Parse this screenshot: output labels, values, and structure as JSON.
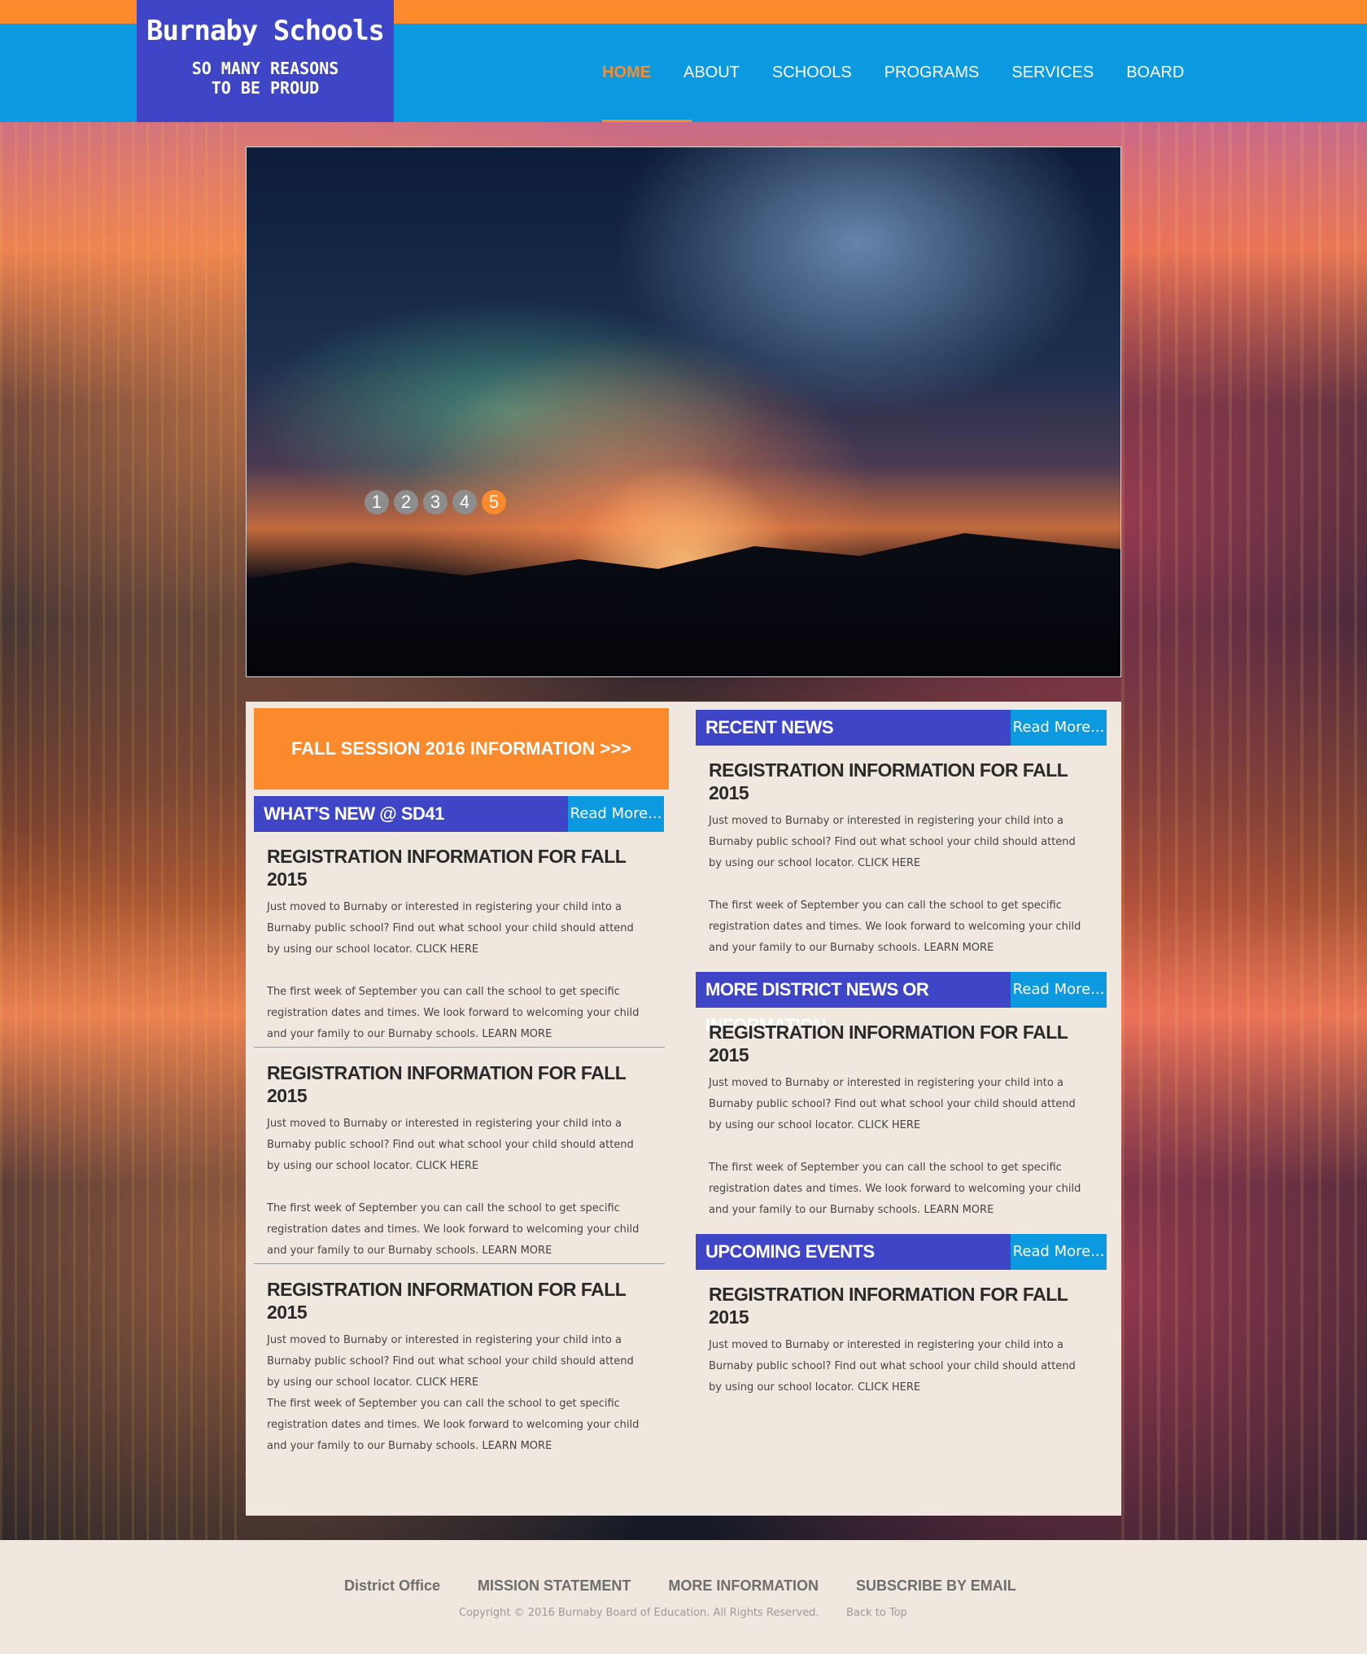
{
  "header": {
    "logo_title": "Burnaby Schools",
    "logo_tagline_1": "SO MANY REASONS",
    "logo_tagline_2": "TO BE PROUD",
    "nav": [
      "HOME",
      "ABOUT",
      "SCHOOLS",
      "PROGRAMS",
      "SERVICES",
      "BOARD"
    ],
    "active_nav": "HOME"
  },
  "slider": {
    "dots": [
      "1",
      "2",
      "3",
      "4",
      "5"
    ],
    "active_dot": "5"
  },
  "banner": {
    "label": "FALL SESSION 2016 INFORMATION >>>"
  },
  "read_more_label": "Read More...",
  "sections": {
    "whats_new": "WHAT'S NEW @ SD41",
    "recent_news": "RECENT NEWS",
    "district_news": "MORE DISTRICT NEWS OR INFORMATION",
    "upcoming_events": "UPCOMING EVENTS"
  },
  "article": {
    "title": "REGISTRATION INFORMATION FOR FALL 2015",
    "p1": "Just moved to Burnaby or interested in registering your child into a Burnaby public school? Find out what school your child should attend by using our school locator.",
    "click_here": "CLICK HERE",
    "p2": "The first week of September you can call the school to get specific registration dates and times. We look forward to welcoming your child and your family to our Burnaby schools.",
    "learn_more": "LEARN MORE"
  },
  "footer": {
    "links": [
      "District Office",
      "MISSION STATEMENT",
      "MORE INFORMATION",
      "SUBSCRIBE BY EMAIL"
    ],
    "copyright": "Copyright © 2016 Burnaby Board of Education. All Rights Reserved.",
    "back_to_top": "Back to Top"
  },
  "colors": {
    "orange": "#fb8a2c",
    "blue": "#0b9ae0",
    "indigo": "#3e46c7",
    "panel": "#f0e8df"
  }
}
